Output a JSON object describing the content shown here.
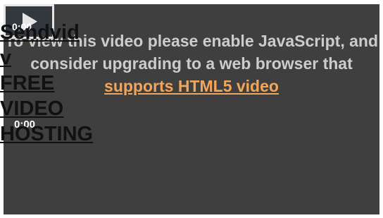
{
  "player": {
    "message": "To view this video please enable JavaScript, and consider upgrading to a web browser that",
    "link_text": "supports HTML5 video",
    "time_top": "0:00",
    "time_bottom": "0:00"
  },
  "brand": {
    "lines": [
      "Sendvid",
      "v",
      "FREE",
      "VIDEO",
      "HOSTING"
    ]
  },
  "colors": {
    "player_bg": "#3f3f3f",
    "message": "#cccccc",
    "link": "#f2a65a",
    "brand_text": "#111111"
  },
  "icons": [
    "play-icon"
  ]
}
